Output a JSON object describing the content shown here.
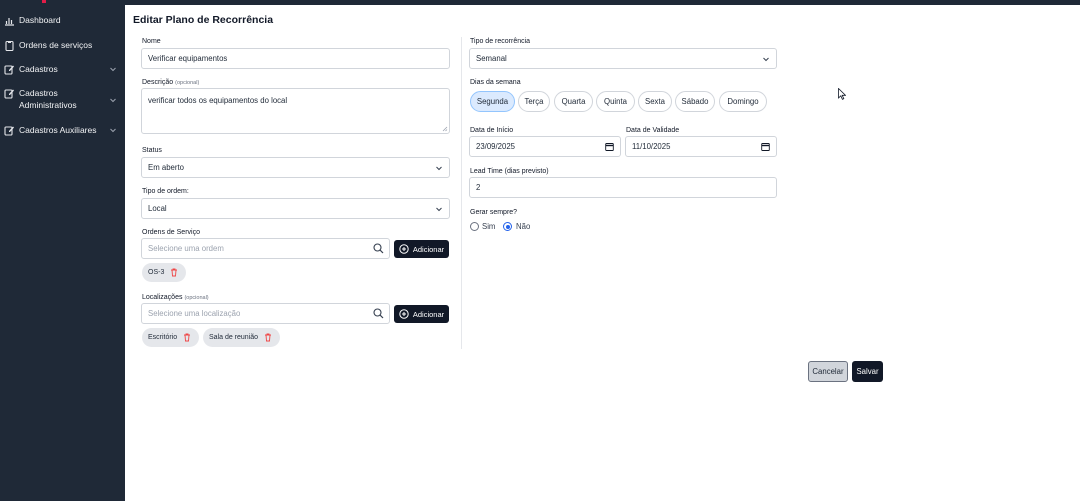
{
  "sidebar": {
    "items": [
      {
        "label": "Dashboard",
        "icon": "chart-icon"
      },
      {
        "label": "Ordens de serviços",
        "icon": "clipboard-icon"
      },
      {
        "label": "Cadastros",
        "icon": "edit-icon"
      },
      {
        "label": "Cadastros Administrativos",
        "icon": "edit-icon"
      },
      {
        "label": "Cadastros Auxiliares",
        "icon": "edit-icon"
      }
    ]
  },
  "page": {
    "title": "Editar Plano de Recorrência"
  },
  "form": {
    "nome": {
      "label": "Nome",
      "value": "Verificar equipamentos"
    },
    "descricao": {
      "label": "Descrição",
      "optional": "(opcional)",
      "value": "verificar todos os equipamentos do local"
    },
    "status": {
      "label": "Status",
      "value": "Em aberto"
    },
    "tipo_ordem": {
      "label": "Tipo de ordem:",
      "value": "Local"
    },
    "ordens": {
      "label": "Ordens de Serviço",
      "placeholder": "Selecione uma ordem",
      "add_label": "Adicionar",
      "chips": [
        "OS-3"
      ]
    },
    "localizacoes": {
      "label": "Localizações",
      "optional": "(opcional)",
      "placeholder": "Selecione uma localização",
      "add_label": "Adicionar",
      "chips": [
        "Escritório",
        "Sala de reunião"
      ]
    },
    "tipo_recorrencia": {
      "label": "Tipo de recorrência",
      "value": "Semanal"
    },
    "dias_semana": {
      "label": "Dias da semana",
      "days": [
        "Segunda",
        "Terça",
        "Quarta",
        "Quinta",
        "Sexta",
        "Sábado",
        "Domingo"
      ],
      "selected": "Segunda"
    },
    "data_inicio": {
      "label": "Data de Início",
      "value": "23/09/2025"
    },
    "data_validade": {
      "label": "Data de Validade",
      "value": "11/10/2025"
    },
    "lead_time": {
      "label": "Lead Time (dias previsto)",
      "value": "2"
    },
    "gerar_sempre": {
      "label": "Gerar sempre?",
      "options": [
        "Sim",
        "Não"
      ],
      "selected": "Não"
    }
  },
  "actions": {
    "cancel_label": "Cancelar",
    "save_label": "Salvar"
  },
  "colors": {
    "sidebar_bg": "#1f2937",
    "primary_dark": "#111827",
    "selected_day_bg": "#dbeafe",
    "radio_accent": "#2563eb",
    "trash_red": "#ef4444"
  }
}
